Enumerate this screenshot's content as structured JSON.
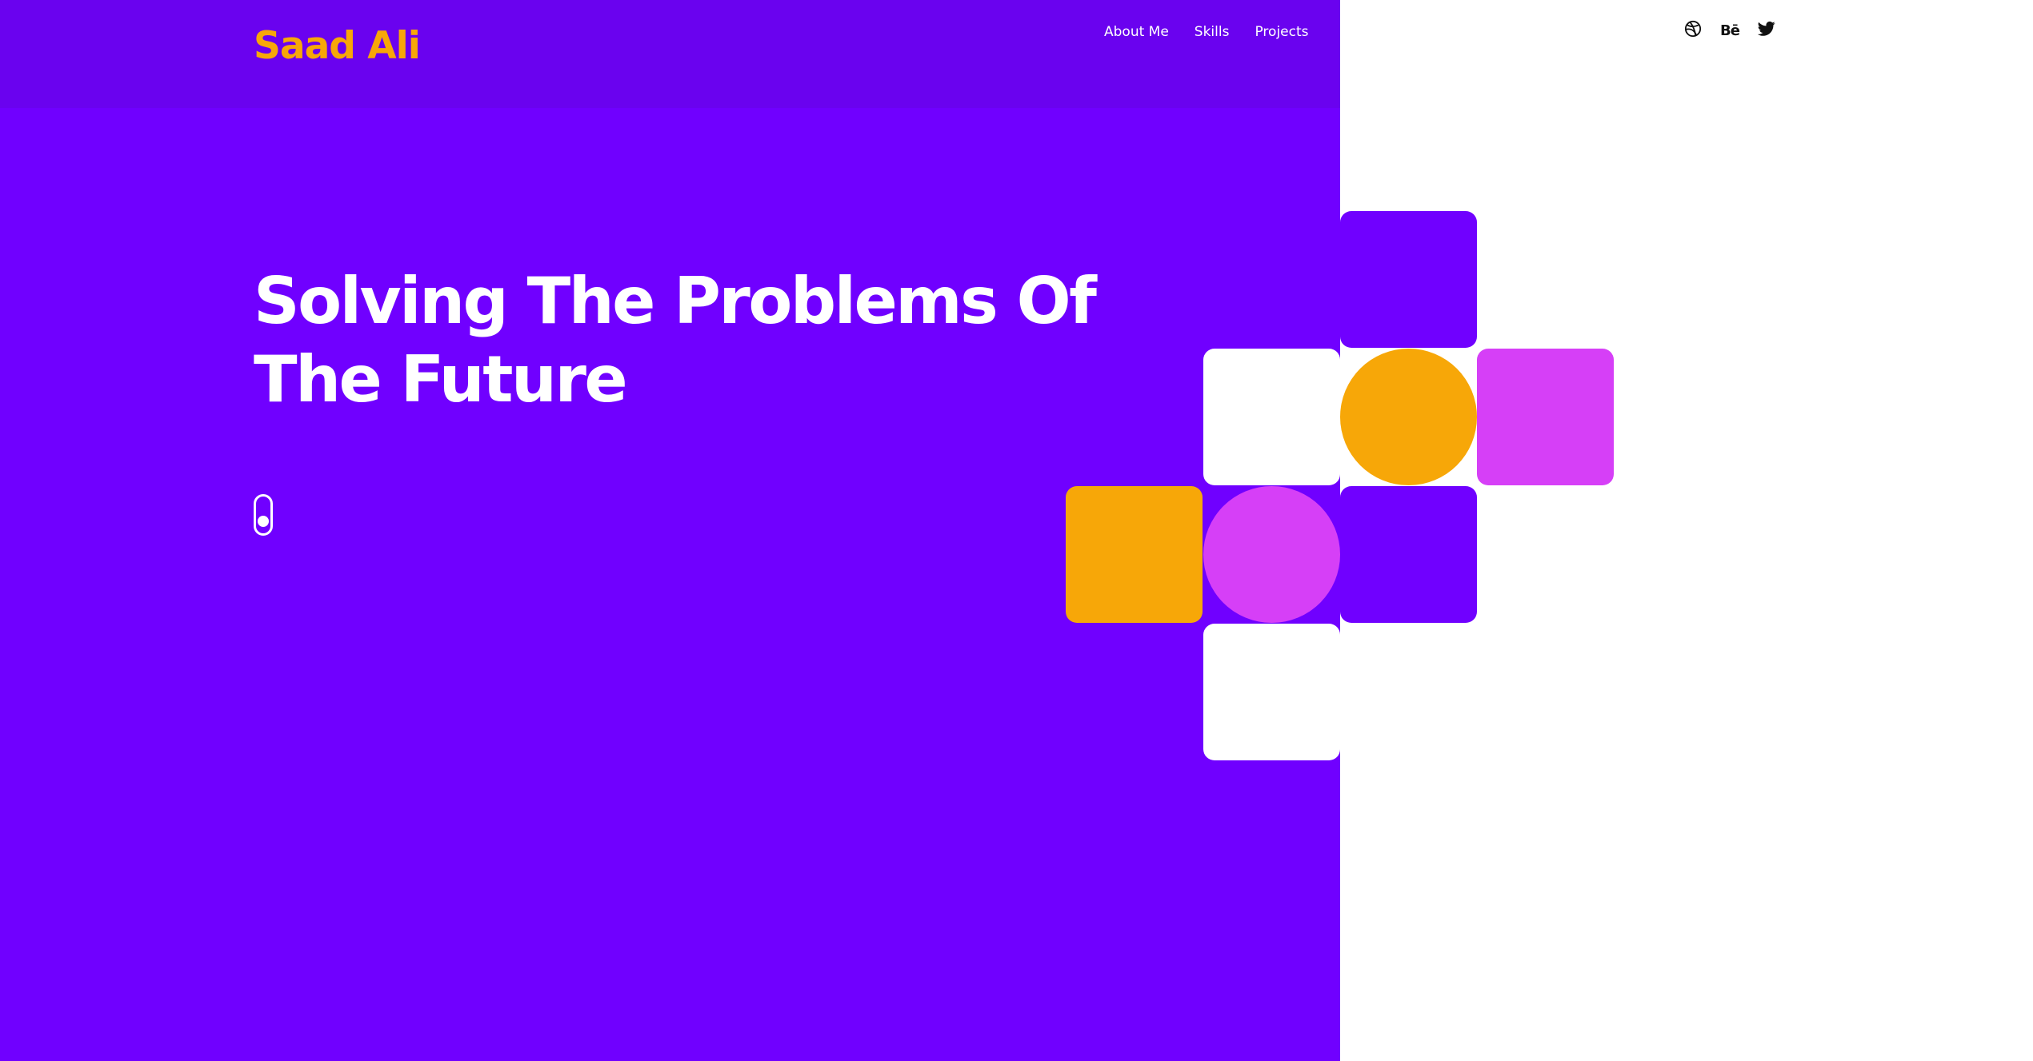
{
  "brand": {
    "name": "Saad Ali"
  },
  "nav": {
    "items": [
      {
        "label": "About Me"
      },
      {
        "label": "Skills"
      },
      {
        "label": "Projects"
      }
    ]
  },
  "hero": {
    "headline_line1": "Solving The Problems Of",
    "headline_line2": "The Future"
  },
  "socials": {
    "items": [
      {
        "icon": "dribbble-icon"
      },
      {
        "icon": "behance-icon",
        "text": "Bē"
      },
      {
        "icon": "twitter-icon"
      }
    ]
  },
  "colors": {
    "primary_purple": "#7000ff",
    "header_purple": "#6a02ef",
    "brand_orange": "#f7a708",
    "magenta": "#d63ff7",
    "white": "#ffffff"
  }
}
